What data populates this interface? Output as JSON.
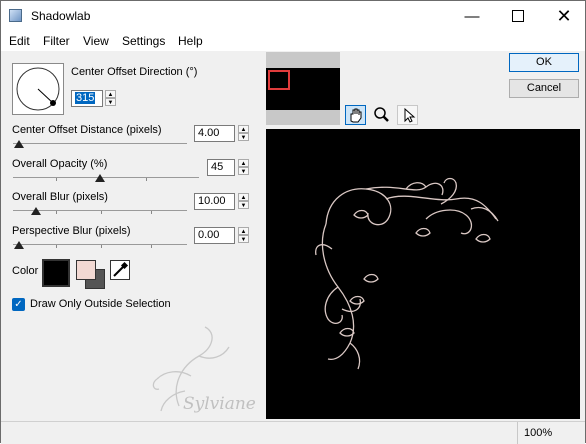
{
  "window": {
    "title": "Shadowlab"
  },
  "menu": [
    "Edit",
    "Filter",
    "View",
    "Settings",
    "Help"
  ],
  "controls": {
    "direction_label": "Center Offset Direction (°)",
    "direction_value": "315",
    "distance_label": "Center Offset Distance (pixels)",
    "distance_value": "4.00",
    "opacity_label": "Overall Opacity (%)",
    "opacity_value": "45",
    "blur_label": "Overall Blur (pixels)",
    "blur_value": "10.00",
    "persp_label": "Perspective Blur (pixels)",
    "persp_value": "0.00",
    "color_label": "Color",
    "checkbox_label": "Draw Only Outside Selection",
    "checkbox_checked": true
  },
  "buttons": {
    "ok": "OK",
    "cancel": "Cancel"
  },
  "status": {
    "zoom": "100%"
  },
  "colors": {
    "shadow": "#000000",
    "swatch_fg": "#f2d9d3",
    "swatch_bg": "#555555",
    "accent": "#0067c0"
  },
  "watermark": "Sylviane"
}
